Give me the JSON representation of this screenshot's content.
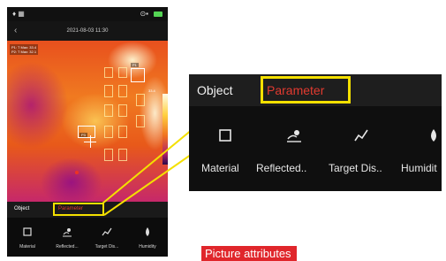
{
  "phone": {
    "status": {
      "left": "♦ ▦",
      "right": "⊙▪"
    },
    "title": {
      "back_glyph": "‹",
      "timestamp": "2021-08-03 11:30"
    },
    "overlay": {
      "info_lines": [
        "P1: T Max: 33.4",
        "P2: T Max: 32.1"
      ],
      "spot_label": "P1 ",
      "center_label": "P3 ",
      "scale_value": "33.4"
    },
    "tabs": {
      "object": "Object",
      "parameter": "Parameter"
    },
    "items": [
      {
        "icon": "square-icon",
        "label": "Material"
      },
      {
        "icon": "pin-icon",
        "label": "Reflected..."
      },
      {
        "icon": "distance-icon",
        "label": "Target Dis..."
      },
      {
        "icon": "drop-icon",
        "label": "Humidity"
      }
    ]
  },
  "zoom": {
    "tabs": {
      "object": "Object",
      "parameter": "Parameter"
    },
    "items": [
      {
        "icon": "square-icon",
        "label": "Material"
      },
      {
        "icon": "pin-icon",
        "label": "Reflected.."
      },
      {
        "icon": "distance-icon",
        "label": "Target Dis.."
      },
      {
        "icon": "drop-icon",
        "label": "Humidit"
      }
    ]
  },
  "caption": "Picture attributes",
  "colors": {
    "accent_red": "#e23a30",
    "highlight_yellow": "#f4e000",
    "caption_bg": "#e0262b"
  }
}
